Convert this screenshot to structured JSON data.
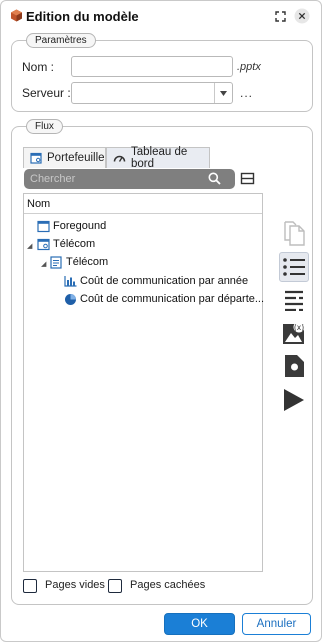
{
  "window": {
    "title": "Edition du modèle"
  },
  "params": {
    "legend": "Paramètres",
    "name_label": "Nom :",
    "name_value": "",
    "name_ext": ".pptx",
    "server_label": "Serveur :",
    "server_value": "",
    "browse_label": "..."
  },
  "flux": {
    "legend": "Flux",
    "tabs": [
      {
        "label": "Portefeuille",
        "icon": "portfolio-icon",
        "active": false
      },
      {
        "label": "Tableau de bord",
        "icon": "gauge-icon",
        "active": true
      }
    ],
    "search_placeholder": "Chercher",
    "column_header": "Nom",
    "tree": [
      {
        "label": "Foregound",
        "icon": "page-icon",
        "level": 0
      },
      {
        "label": "Télécom",
        "icon": "page-icon",
        "level": 0,
        "expanded": true
      },
      {
        "label": "Télécom",
        "icon": "document-icon",
        "level": 1,
        "expanded": true
      },
      {
        "label": "Coût de communication par année",
        "icon": "bar-chart-icon",
        "level": 2
      },
      {
        "label": "Coût de communication par départe...",
        "icon": "pie-chart-icon",
        "level": 2
      }
    ],
    "side_tools": [
      "copy-pages-icon",
      "list-icon",
      "text-lines-icon",
      "variable-image-icon",
      "record-icon",
      "play-icon"
    ],
    "empty_pages_label": "Pages vides",
    "hidden_pages_label": "Pages cachées"
  },
  "buttons": {
    "ok": "OK",
    "cancel": "Annuler"
  },
  "colors": {
    "accent": "#1b7fd6",
    "icon_blue": "#2a6db5",
    "dark_icon": "#3a3a3a"
  }
}
